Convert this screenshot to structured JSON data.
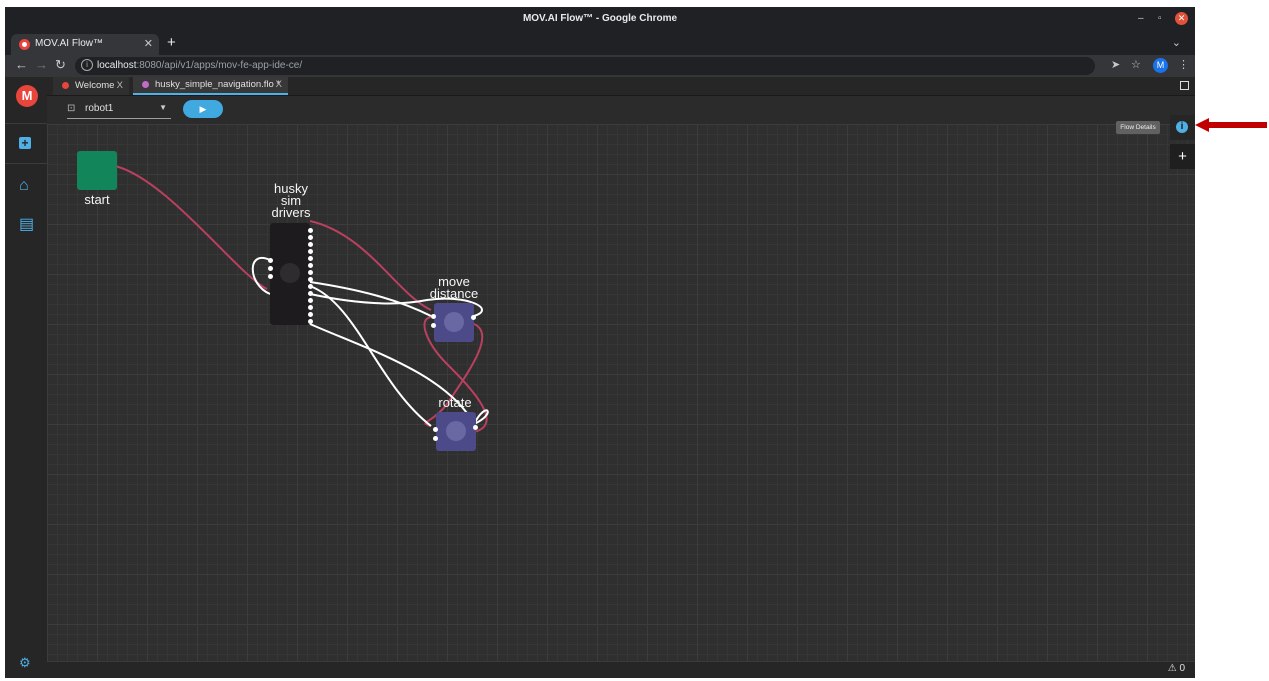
{
  "window": {
    "title": "MOV.AI Flow™ - Google Chrome",
    "minimize": "–",
    "restore": "▫",
    "close": "✕"
  },
  "browser": {
    "tab_label": "MOV.AI Flow™",
    "tab_close": "✕",
    "new_tab": "+",
    "tab_menu": "⌄",
    "url_host": "localhost",
    "url_path": ":8080/api/v1/apps/mov-fe-app-ide-ce/",
    "profile_initial": "M"
  },
  "sidebar": {
    "logo": "M",
    "add_glyph": "+",
    "home_glyph": "⌂",
    "doc_glyph": "▤",
    "settings_glyph": "⚙"
  },
  "app_tabs": [
    {
      "label": "Welcome",
      "close": "X"
    },
    {
      "label": "husky_simple_navigation.flo *",
      "close": "X"
    }
  ],
  "toolbar": {
    "robot": "robot1",
    "play_glyph": "▶"
  },
  "nodes": {
    "start": {
      "label": "start"
    },
    "drivers": {
      "label": "husky\nsim\ndrivers"
    },
    "move": {
      "label": "move\ndistance"
    },
    "rotate": {
      "label": "rotate"
    }
  },
  "dock": {
    "flow_details_tooltip": "Flow Details",
    "info_glyph": "i",
    "add_glyph": "+"
  },
  "status": {
    "warning_glyph": "⚠",
    "warning_count": "0"
  },
  "colors": {
    "accent": "#4fb0e6",
    "start_node": "#12855a",
    "drivers_node": "#1e1b1e",
    "action_node": "#4d4a8a",
    "link_primary": "#b9405f",
    "link_data": "#ffffff",
    "annotation_arrow": "#c00000"
  }
}
